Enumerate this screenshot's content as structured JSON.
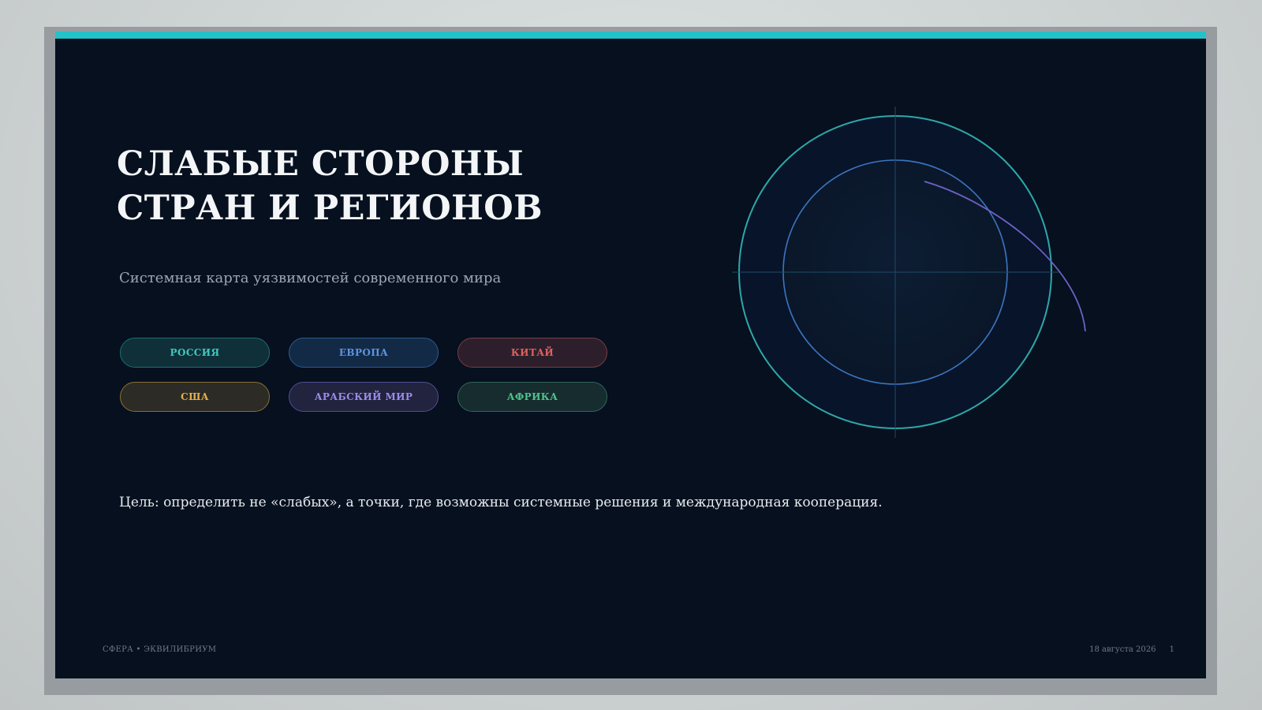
{
  "slide": {
    "title_lines": [
      "СЛАБЫЕ СТОРОНЫ",
      "СТРАН И РЕГИОНОВ"
    ],
    "subtitle": "Системная карта уязвимостей современного мира",
    "goal": "Цель: определить не «слабых», а точки, где возможны системные решения и международная кооперация.",
    "accent_color": "#24c2c8",
    "background_color": "#06101f"
  },
  "tags": [
    {
      "label": "РОССИЯ",
      "text_color": "#3fc9c2",
      "bg": "#0f3038",
      "border": "#1f6d72"
    },
    {
      "label": "ЕВРОПА",
      "text_color": "#5b95e3",
      "bg": "#132a47",
      "border": "#2c5a8f"
    },
    {
      "label": "КИТАЙ",
      "text_color": "#e0605e",
      "bg": "#2c1f2b",
      "border": "#7a3c44"
    },
    {
      "label": "США",
      "text_color": "#e3b04b",
      "bg": "#2c2b26",
      "border": "#8a6f30"
    },
    {
      "label": "АРАБСКИЙ МИР",
      "text_color": "#9b8ce8",
      "bg": "#22233f",
      "border": "#514c92"
    },
    {
      "label": "АФРИКА",
      "text_color": "#4fc28d",
      "bg": "#162c2e",
      "border": "#2e6658"
    }
  ],
  "footer": {
    "brand": "СФЕРА • ЭКВИЛИБРИУМ",
    "date": "18 августа 2026",
    "page": "1"
  }
}
